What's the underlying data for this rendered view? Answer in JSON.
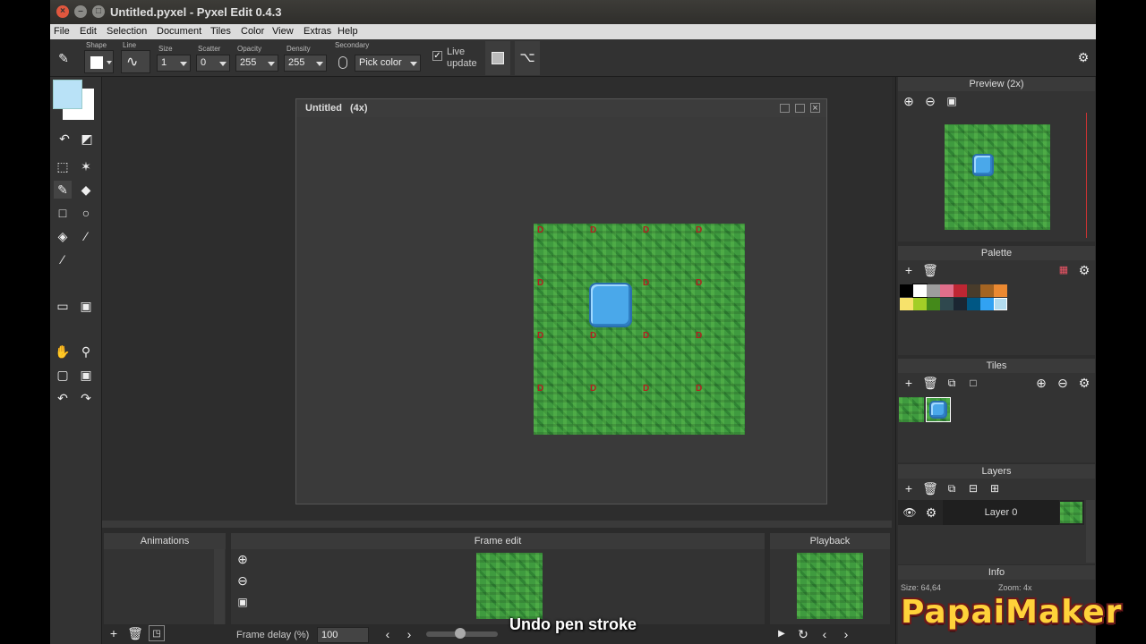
{
  "window": {
    "title": "Untitled.pyxel - Pyxel Edit 0.4.3"
  },
  "menu": [
    "File",
    "Edit",
    "Selection",
    "Document",
    "Tiles",
    "Color",
    "View",
    "Extras",
    "Help"
  ],
  "toolbar": {
    "shape_label": "Shape",
    "line_label": "Line",
    "size_label": "Size",
    "size_value": "1",
    "scatter_label": "Scatter",
    "scatter_value": "0",
    "opacity_label": "Opacity",
    "opacity_value": "255",
    "density_label": "Density",
    "density_value": "255",
    "secondary_label": "Secondary",
    "secondary_value": "Pick color",
    "live_update_line1": "Live",
    "live_update_line2": "update"
  },
  "colors": {
    "primary": "#b9e2f7",
    "secondary": "#ffffff"
  },
  "document": {
    "title": "Untitled",
    "zoom": "(4x)"
  },
  "bottom": {
    "animations_title": "Animations",
    "frame_edit_title": "Frame edit",
    "playback_title": "Playback",
    "frame_delay_label": "Frame delay (%)",
    "frame_delay_value": "100"
  },
  "right": {
    "preview_title": "Preview (2x)",
    "palette_title": "Palette",
    "tiles_title": "Tiles",
    "layers_title": "Layers",
    "layer_name": "Layer 0",
    "info_title": "Info",
    "info_size": "Size: 64,64",
    "info_zoom": "Zoom: 4x"
  },
  "palette": [
    "#000000",
    "#ffffff",
    "#9d9d9d",
    "#e06f8b",
    "#be2633",
    "#493c2b",
    "#a46422",
    "#eb8931",
    "#f7e26b",
    "#a3ce27",
    "#44891a",
    "#2f484e",
    "#1b2632",
    "#005784",
    "#31a2f2",
    "#b2dcef"
  ],
  "overlay": {
    "subtitle": "Undo pen stroke",
    "watermark": "PapaiMaker"
  }
}
